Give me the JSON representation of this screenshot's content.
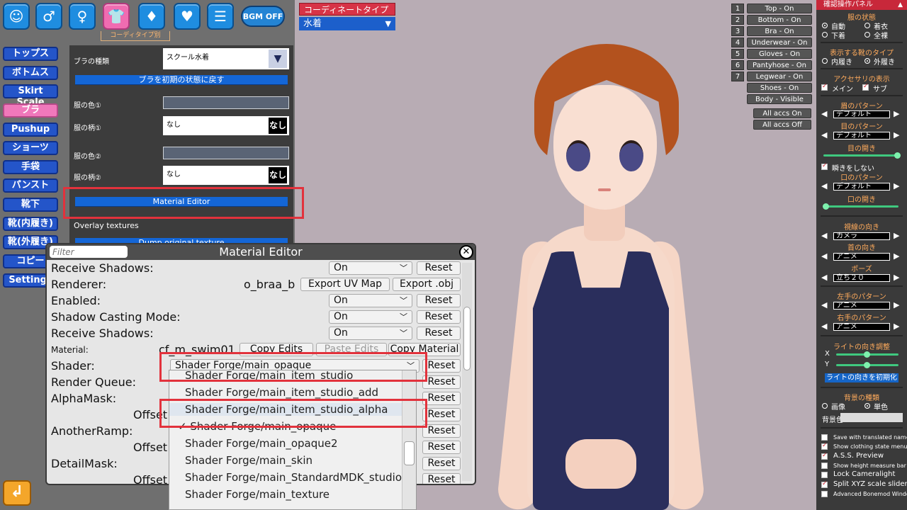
{
  "top_icons": [
    {
      "name": "face-icon",
      "glyph": "☺"
    },
    {
      "name": "body-icon",
      "glyph": "♂"
    },
    {
      "name": "hair-icon",
      "glyph": "♀"
    },
    {
      "name": "clothes-icon",
      "glyph": "👕"
    },
    {
      "name": "accessory-icon",
      "glyph": "♦"
    },
    {
      "name": "heart-icon",
      "glyph": "♥"
    },
    {
      "name": "document-icon",
      "glyph": "☰"
    }
  ],
  "bgm_label": "BGM OFF",
  "coordinate_sublabel": "コーディタイプ別",
  "coordinate_type": {
    "label": "コーディネートタイプ",
    "value": "水着"
  },
  "categories": [
    "トップス",
    "ボトムス",
    "Skirt Scale",
    "ブラ",
    "Pushup",
    "ショーツ",
    "手袋",
    "パンスト",
    "靴下",
    "靴(内履き)",
    "靴(外履き)",
    "コピー",
    "Settings"
  ],
  "active_category": "ブラ",
  "bra_panel": {
    "type_label": "ブラの種類",
    "type_value": "スクール水着",
    "reset_button": "ブラを初期の状態に戻す",
    "color1_label": "服の色①",
    "pattern1_label": "服の柄①",
    "pattern1_value": "なし",
    "pattern1_badge": "なし",
    "color2_label": "服の色②",
    "pattern2_label": "服の柄②",
    "pattern2_value": "なし",
    "pattern2_badge": "なし",
    "material_editor_button": "Material Editor",
    "overlay_label": "Overlay textures",
    "dump_button": "Dump original texture"
  },
  "material_editor": {
    "title": "Material Editor",
    "filter_placeholder": "Filter",
    "rows": {
      "receive_shadows_top": {
        "label": "Receive Shadows:",
        "value": "On",
        "reset": "Reset"
      },
      "renderer": {
        "label": "Renderer:",
        "name": "o_braa_b",
        "export_uv": "Export UV Map",
        "export_obj": "Export .obj"
      },
      "enabled": {
        "label": "Enabled:",
        "value": "On",
        "reset": "Reset"
      },
      "shadow_casting": {
        "label": "Shadow Casting Mode:",
        "value": "On",
        "reset": "Reset"
      },
      "receive_shadows": {
        "label": "Receive Shadows:",
        "value": "On",
        "reset": "Reset"
      },
      "material": {
        "label": "Material:",
        "name": "cf_m_swim01",
        "copy": "Copy Edits",
        "paste": "Paste Edits",
        "copy_material": "Copy Material"
      },
      "shader": {
        "label": "Shader:",
        "value": "Shader Forge/main_opaque",
        "reset": "Reset"
      },
      "render_queue": {
        "label": "Render Queue:",
        "reset": "Reset"
      },
      "alpha_mask": {
        "label": "AlphaMask:",
        "reset": "Reset"
      },
      "offset1": {
        "label": "Offset",
        "reset": "Reset"
      },
      "another_ramp": {
        "label": "AnotherRamp:",
        "reset": "Reset"
      },
      "offset2": {
        "label": "Offset",
        "reset": "Reset"
      },
      "detail_mask": {
        "label": "DetailMask:",
        "reset": "Reset"
      },
      "offset3": {
        "label": "Offset",
        "reset": "Reset"
      }
    }
  },
  "shader_options": [
    "Shader Forge/main_item_studio",
    "Shader Forge/main_item_studio_add",
    "Shader Forge/main_item_studio_alpha",
    "✓ Shader Forge/main_opaque",
    "Shader Forge/main_opaque2",
    "Shader Forge/main_skin",
    "Shader Forge/main_StandardMDK_studio",
    "Shader Forge/main_texture"
  ],
  "layer_toggles": [
    {
      "num": "1",
      "label": "Top - On"
    },
    {
      "num": "2",
      "label": "Bottom - On"
    },
    {
      "num": "3",
      "label": "Bra - On"
    },
    {
      "num": "4",
      "label": "Underwear - On"
    },
    {
      "num": "5",
      "label": "Gloves - On"
    },
    {
      "num": "6",
      "label": "Pantyhose - On"
    },
    {
      "num": "7",
      "label": "Legwear - On"
    },
    {
      "num": "",
      "label": "Shoes - On"
    },
    {
      "num": "",
      "label": "Body - Visible"
    }
  ],
  "accs_buttons": [
    "All accs On",
    "All accs Off"
  ],
  "right_panel": {
    "header": "確認操作パネル",
    "clothes_state_title": "服の状態",
    "clothes_state": [
      "自動",
      "着衣",
      "下着",
      "全裸"
    ],
    "shoes_title": "表示する靴のタイプ",
    "shoes_options": [
      "内履き",
      "外履き"
    ],
    "accessory_title": "アクセサリの表示",
    "accessory_options": [
      "メイン",
      "サブ"
    ],
    "eyebrow_title": "眉のパターン",
    "eyebrow_value": "デフォルト",
    "eye_title": "目のパターン",
    "eye_value": "デフォルト",
    "eye_open_title": "目の開き",
    "blink_label": "瞬きをしない",
    "mouth_title": "口のパターン",
    "mouth_value": "デフォルト",
    "mouth_open_title": "口の開き",
    "gaze_title": "視線の向き",
    "gaze_value": "カメラ",
    "neck_title": "首の向き",
    "neck_value": "アニメ",
    "pose_title": "ポーズ",
    "pose_value": "立ち２０",
    "left_hand_title": "左手のパターン",
    "left_hand_value": "アニメ",
    "right_hand_title": "右手のパターン",
    "right_hand_value": "アニメ",
    "light_title": "ライトの向き調整",
    "light_x": "X",
    "light_y": "Y",
    "light_reset": "ライトの向きを初期化",
    "bg_title": "背景の種類",
    "bg_options": [
      "画像",
      "単色"
    ],
    "bg_color_label": "背景色",
    "options": [
      {
        "label": "Save with translated names",
        "checked": false
      },
      {
        "label": "Show clothing state menu",
        "checked": true
      },
      {
        "label": "A.S.S. Preview",
        "checked": true
      },
      {
        "label": "Show height measure bar",
        "checked": false
      },
      {
        "label": "Lock Cameralight",
        "checked": false
      },
      {
        "label": "Split XYZ scale sliders",
        "checked": true
      },
      {
        "label": "Advanced Bonemod Window",
        "checked": false
      }
    ]
  },
  "colors": {
    "accent_blue": "#1466d6",
    "active_pink": "#f06cb1",
    "highlight_red": "#e2323c",
    "panel_header_red": "#c8283a"
  }
}
